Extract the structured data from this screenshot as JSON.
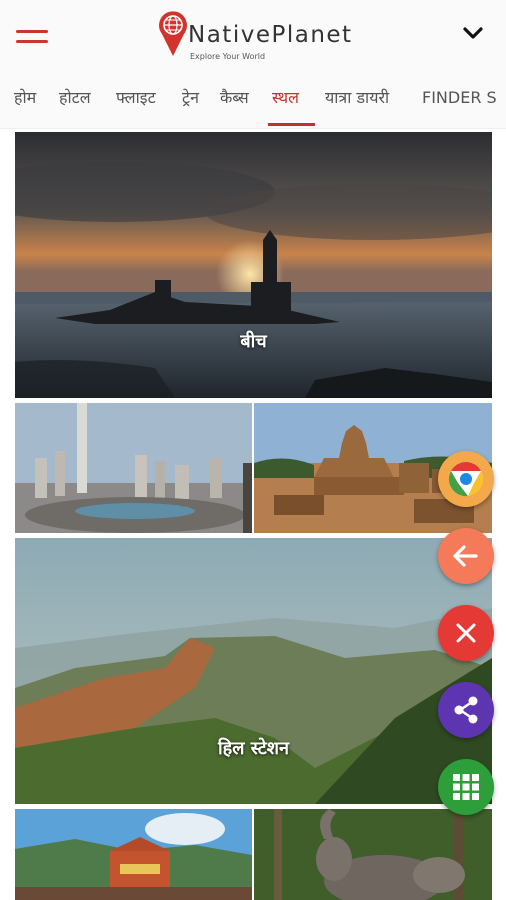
{
  "header": {
    "logo_name": "NativePlanet",
    "logo_tagline": "Explore Your World"
  },
  "tabs": [
    {
      "label": "होम"
    },
    {
      "label": "होटल"
    },
    {
      "label": "फ्लाइट"
    },
    {
      "label": "ट्रेन"
    },
    {
      "label": "कैब्स"
    },
    {
      "label": "स्थल"
    },
    {
      "label": "यात्रा डायरी"
    },
    {
      "label": "FINDER S"
    }
  ],
  "active_tab": "स्थल",
  "tiles": {
    "beach_label": "बीच",
    "hill_station_label": "हिल स्टेशन"
  },
  "fab_colors": {
    "chrome": "#f3a94a",
    "back": "#f47a5a",
    "close": "#e53935",
    "share": "#5e35b1",
    "grid": "#2e9e3a"
  },
  "colors": {
    "accent": "#c0332b"
  }
}
